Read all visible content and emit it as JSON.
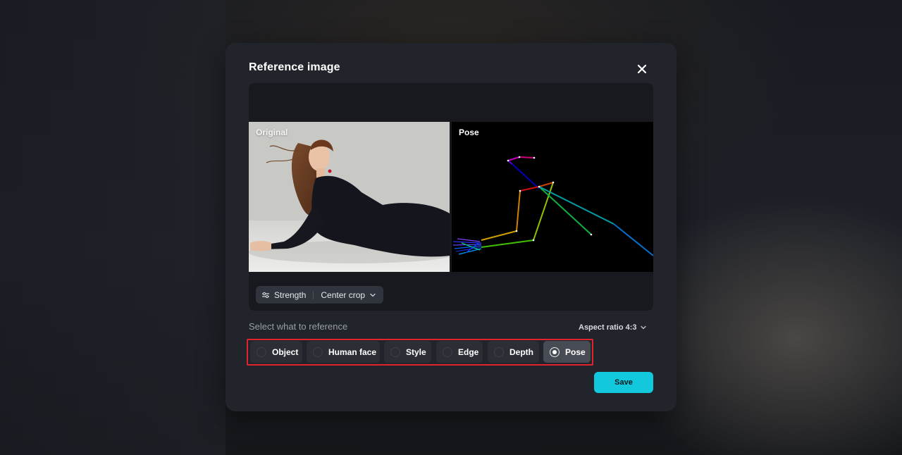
{
  "modal": {
    "title": "Reference image",
    "close_icon": "close-icon"
  },
  "preview": {
    "original_label": "Original",
    "pose_label": "Pose"
  },
  "toolbar": {
    "strength_icon": "sliders-icon",
    "strength_label": "Strength",
    "crop_label": "Center crop",
    "crop_icon": "chevron-down-icon"
  },
  "reference": {
    "section_label": "Select what to reference",
    "aspect_label": "Aspect ratio 4:3",
    "options": [
      {
        "label": "Object",
        "selected": false
      },
      {
        "label": "Human face",
        "selected": false
      },
      {
        "label": "Style",
        "selected": false
      },
      {
        "label": "Edge",
        "selected": false
      },
      {
        "label": "Depth",
        "selected": false
      },
      {
        "label": "Pose",
        "selected": true
      }
    ]
  },
  "actions": {
    "save_label": "Save"
  },
  "colors": {
    "accent": "#12c8dc",
    "highlight_frame": "#e0242f",
    "modal_bg": "#21242b"
  }
}
